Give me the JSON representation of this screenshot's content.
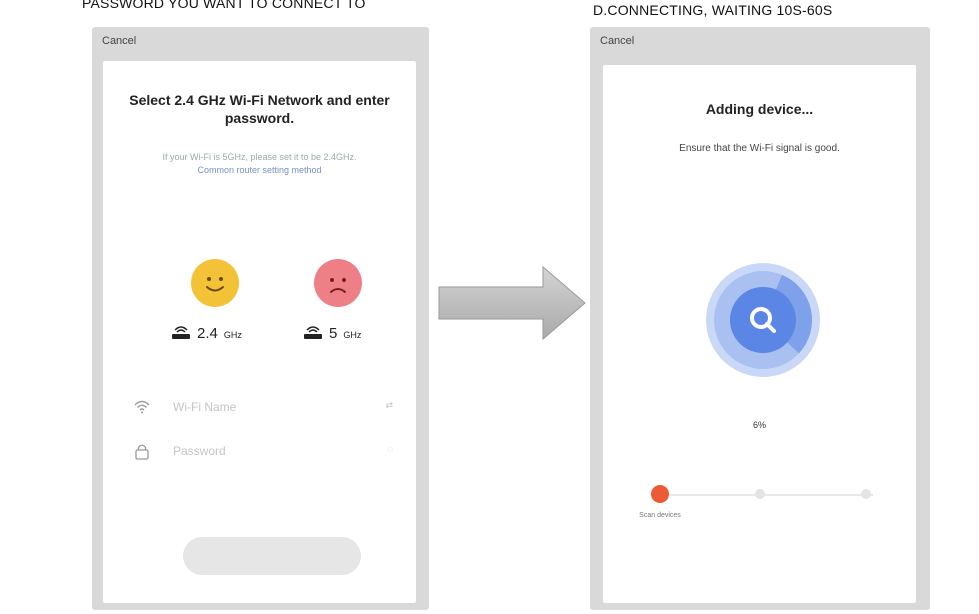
{
  "captions": {
    "left": "PASSWORD  YOU WANT TO CONNECT TO",
    "right": "D.CONNECTING, WAITING 10S-60S"
  },
  "left_screen": {
    "cancel": "Cancel",
    "title": "Select 2.4 GHz Wi-Fi Network and enter password.",
    "hint": "If your Wi-Fi is 5GHz, please set it to be 2.4GHz.",
    "hint_link": "Common router setting method",
    "bands": [
      {
        "main": "2.4",
        "unit": "GHz"
      },
      {
        "main": "5",
        "unit": "GHz"
      }
    ],
    "wifi_name_placeholder": "Wi-Fi Name",
    "password_placeholder": "Password"
  },
  "right_screen": {
    "cancel": "Cancel",
    "title": "Adding device...",
    "subtitle": "Ensure that the Wi-Fi signal is good.",
    "progress": 0.06,
    "progress_text": "6%",
    "steps": [
      {
        "label": "Scan devices",
        "active": true
      },
      {
        "label": "",
        "active": false
      },
      {
        "label": "",
        "active": false
      }
    ]
  },
  "colors": {
    "accent_blue": "#5b86e5",
    "happy": "#f3c237",
    "sad": "#ef7f86",
    "step_active": "#ec5a36"
  }
}
